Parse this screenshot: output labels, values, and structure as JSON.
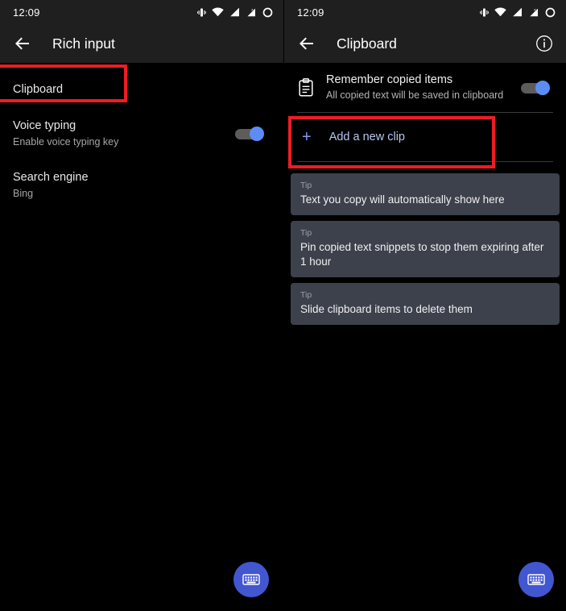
{
  "left_screen": {
    "status_bar": {
      "time": "12:09",
      "icons": [
        "vibrate-icon",
        "wifi-icon",
        "signal-bars-icon",
        "signal-no-sim-icon",
        "battery-circle-icon"
      ]
    },
    "app_bar": {
      "back_icon": "arrow-back-icon",
      "title": "Rich input"
    },
    "settings": [
      {
        "title": "Clipboard",
        "subtitle": "",
        "has_toggle": false,
        "highlighted": true
      },
      {
        "title": "Voice typing",
        "subtitle": "Enable voice typing key",
        "has_toggle": true,
        "toggle_on": true,
        "highlighted": false
      },
      {
        "title": "Search engine",
        "subtitle": "Bing",
        "has_toggle": false,
        "highlighted": false
      }
    ],
    "fab": {
      "icon": "keyboard-icon",
      "color": "#4256d0"
    }
  },
  "right_screen": {
    "status_bar": {
      "time": "12:09",
      "icons": [
        "vibrate-icon",
        "wifi-icon",
        "signal-bars-icon",
        "signal-no-sim-icon",
        "battery-circle-icon"
      ]
    },
    "app_bar": {
      "back_icon": "arrow-back-icon",
      "title": "Clipboard",
      "info_icon": "info-circle-icon"
    },
    "remember": {
      "icon": "clipboard-icon",
      "title": "Remember copied items",
      "subtitle": "All copied text will be saved in clipboard",
      "toggle_on": true
    },
    "add_clip": {
      "plus": "+",
      "label": "Add a new clip",
      "highlighted": true
    },
    "clips": [
      {
        "tip_label": "Tip",
        "text": "Text you copy will automatically show here"
      },
      {
        "tip_label": "Tip",
        "text": "Pin copied text snippets to stop them expiring after 1 hour"
      },
      {
        "tip_label": "Tip",
        "text": "Slide clipboard items to delete them"
      }
    ],
    "fab": {
      "icon": "keyboard-icon",
      "color": "#4256d0"
    }
  },
  "annotations": {
    "highlight_color": "#ee1c24",
    "boxes": [
      "clipboard-setting-row",
      "add-a-new-clip-row"
    ]
  }
}
